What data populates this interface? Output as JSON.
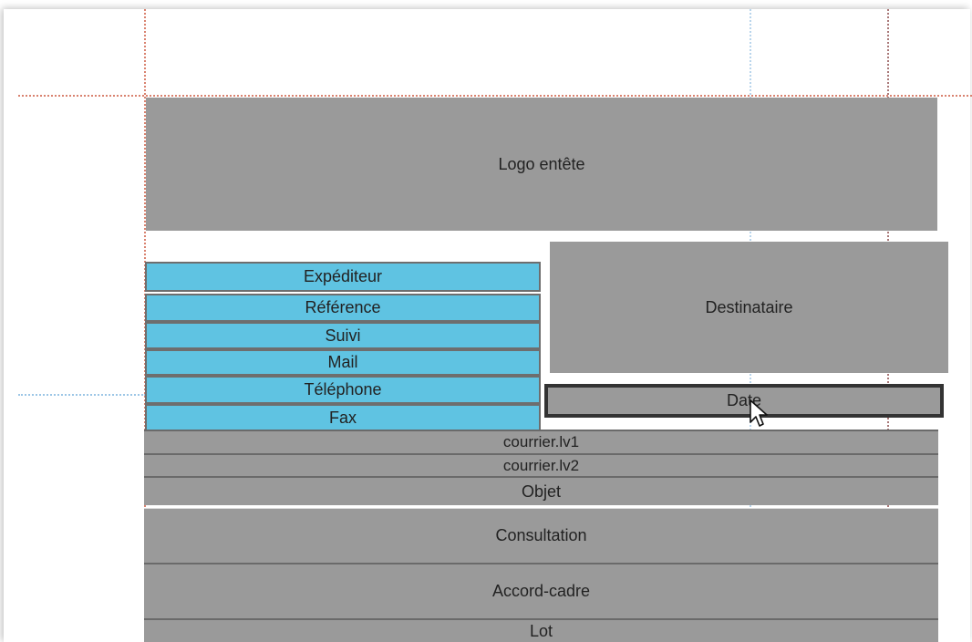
{
  "canvas": {
    "header": {
      "label": "Logo entête"
    },
    "sender_fields": [
      {
        "label": "Expéditeur"
      },
      {
        "label": "Référence"
      },
      {
        "label": "Suivi"
      },
      {
        "label": "Mail"
      },
      {
        "label": "Téléphone"
      },
      {
        "label": "Fax"
      }
    ],
    "recipient": {
      "label": "Destinataire"
    },
    "date": {
      "label": "Date"
    },
    "body_rows": [
      {
        "label": "courrier.lv1"
      },
      {
        "label": "courrier.lv2"
      },
      {
        "label": "Objet"
      },
      {
        "label": "Consultation"
      },
      {
        "label": "Accord-cadre"
      },
      {
        "label": "Lot"
      }
    ]
  },
  "colors": {
    "gray_block": "#9a9a9a",
    "blue_field": "#5fc3e2",
    "guide_red": "#d9826f",
    "guide_blue": "#9cc6e6"
  },
  "icons": {
    "cursor": "mouse-pointer-icon"
  }
}
